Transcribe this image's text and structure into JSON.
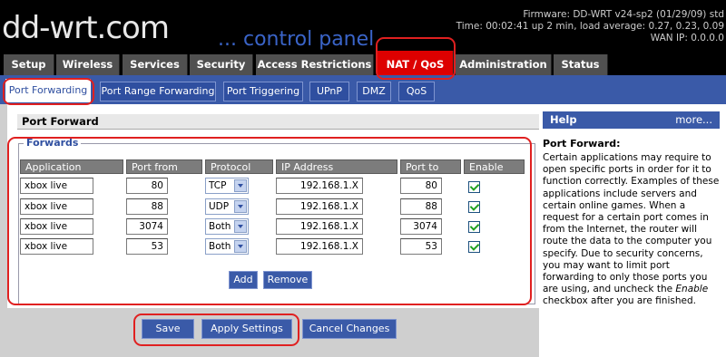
{
  "header": {
    "logo": "dd-wrt.com",
    "tagline": "... control panel",
    "firmware": "Firmware: DD-WRT v24-sp2 (01/29/09) std",
    "time": "Time: 00:02:41 up 2 min, load average: 0.27, 0.23, 0.09",
    "wan_ip": "WAN IP: 0.0.0.0"
  },
  "main_tabs": [
    "Setup",
    "Wireless",
    "Services",
    "Security",
    "Access Restrictions",
    "NAT / QoS",
    "Administration",
    "Status"
  ],
  "sub_tabs": [
    "Port Forwarding",
    "Port Range Forwarding",
    "Port Triggering",
    "UPnP",
    "DMZ",
    "QoS"
  ],
  "section_title": "Port Forward",
  "forwards": {
    "legend": "Forwards",
    "columns": [
      "Application",
      "Port from",
      "Protocol",
      "IP Address",
      "Port to",
      "Enable"
    ],
    "rows": [
      {
        "application": "xbox live",
        "port_from": "80",
        "protocol": "TCP",
        "ip": "192.168.1.X",
        "port_to": "80",
        "enabled": true
      },
      {
        "application": "xbox live",
        "port_from": "88",
        "protocol": "UDP",
        "ip": "192.168.1.X",
        "port_to": "88",
        "enabled": true
      },
      {
        "application": "xbox live",
        "port_from": "3074",
        "protocol": "Both",
        "ip": "192.168.1.X",
        "port_to": "3074",
        "enabled": true
      },
      {
        "application": "xbox live",
        "port_from": "53",
        "protocol": "Both",
        "ip": "192.168.1.X",
        "port_to": "53",
        "enabled": true
      }
    ],
    "add_label": "Add",
    "remove_label": "Remove"
  },
  "actions": {
    "save": "Save",
    "apply": "Apply Settings",
    "cancel": "Cancel Changes"
  },
  "help": {
    "heading": "Help",
    "more": "more...",
    "title": "Port Forward:",
    "text_before": "Certain applications may require to open specific ports in order for it to function correctly. Examples of these applications include servers and certain online games. When a request for a certain port comes in from the Internet, the router will route the data to the computer you specify. Due to security concerns, you may want to limit port forwarding to only those ports you are using, and uncheck the ",
    "text_em": "Enable",
    "text_after": " checkbox after you are finished."
  },
  "colors": {
    "accent_blue": "#3a5aa8",
    "active_tab_red": "#dd0000",
    "annotation_red": "#e02020"
  }
}
